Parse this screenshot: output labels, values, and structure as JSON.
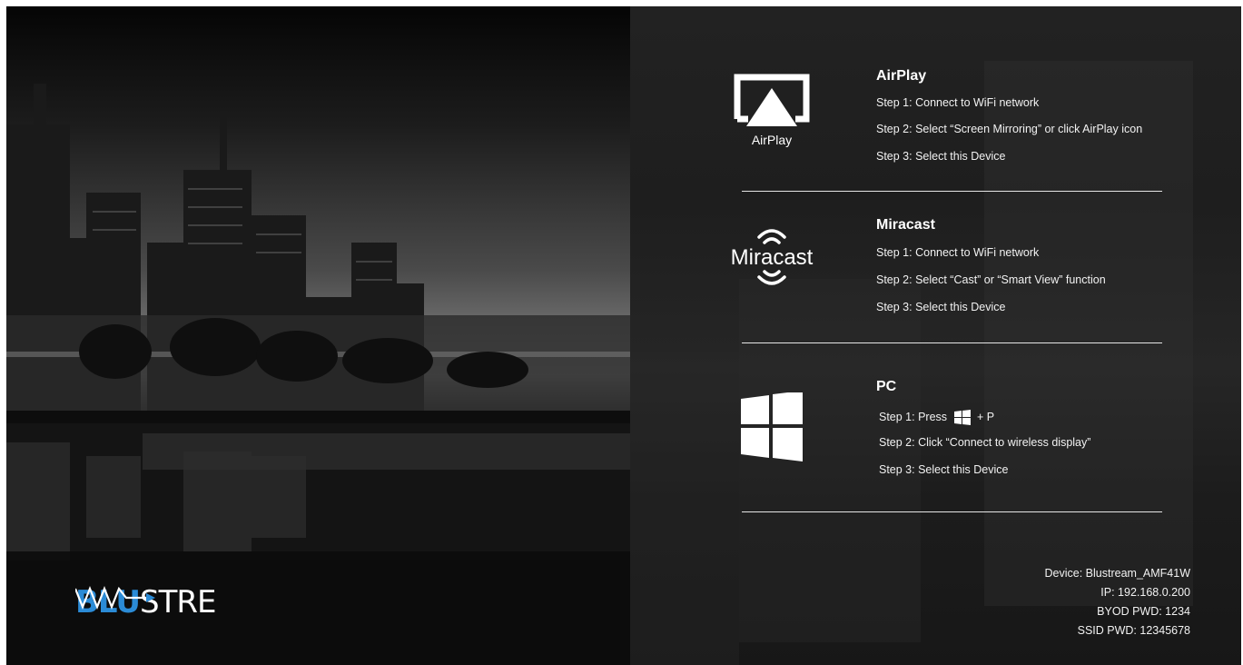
{
  "logo": {
    "part1": "BLU",
    "part2": "STRE"
  },
  "airplay": {
    "icon_label": "AirPlay",
    "title": "AirPlay",
    "steps": [
      "Step 1: Connect to WiFi network",
      "Step 2: Select  “Screen Mirroring” or click AirPlay icon",
      "Step 3: Select this Device"
    ]
  },
  "miracast": {
    "icon_label": "Miracast",
    "title": "Miracast",
    "steps": [
      "Step 1: Connect to WiFi network",
      "Step 2: Select “Cast” or “Smart View” function",
      "Step 3: Select this Device"
    ]
  },
  "pc": {
    "title": "PC",
    "step1_prefix": "Step 1: Press",
    "step1_suffix": "+ P",
    "steps": [
      "Step 2: Click “Connect to wireless display”",
      "Step 3: Select this Device"
    ]
  },
  "device": {
    "name": "Device: Blustream_AMF41W",
    "ip": "IP: 192.168.0.200",
    "byod_pwd": "BYOD PWD: 1234",
    "ssid_pwd": "SSID PWD: 12345678"
  },
  "colors": {
    "brand_blue": "#2b8bd6",
    "background": "#1b1b1b",
    "text": "#ffffff"
  }
}
